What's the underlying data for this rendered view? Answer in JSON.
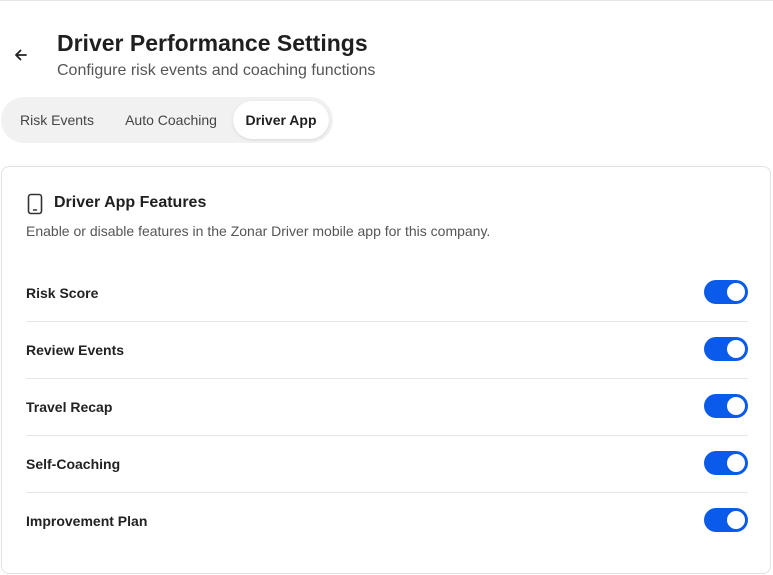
{
  "header": {
    "title": "Driver Performance Settings",
    "subtitle": "Configure risk events and coaching functions",
    "back_icon": "arrow-left-icon"
  },
  "tabs": [
    {
      "label": "Risk Events",
      "active": false
    },
    {
      "label": "Auto Coaching",
      "active": false
    },
    {
      "label": "Driver App",
      "active": true
    }
  ],
  "card": {
    "icon": "smartphone-icon",
    "title": "Driver App Features",
    "description": "Enable or disable features in the Zonar Driver mobile app for this company.",
    "features": [
      {
        "label": "Risk Score",
        "enabled": true
      },
      {
        "label": "Review Events",
        "enabled": true
      },
      {
        "label": "Travel Recap",
        "enabled": true
      },
      {
        "label": "Self-Coaching",
        "enabled": true
      },
      {
        "label": "Improvement Plan",
        "enabled": true
      }
    ]
  },
  "colors": {
    "accent": "#0a5bea",
    "tab_track": "#f1f1f1",
    "divider": "#e6e6e6"
  }
}
